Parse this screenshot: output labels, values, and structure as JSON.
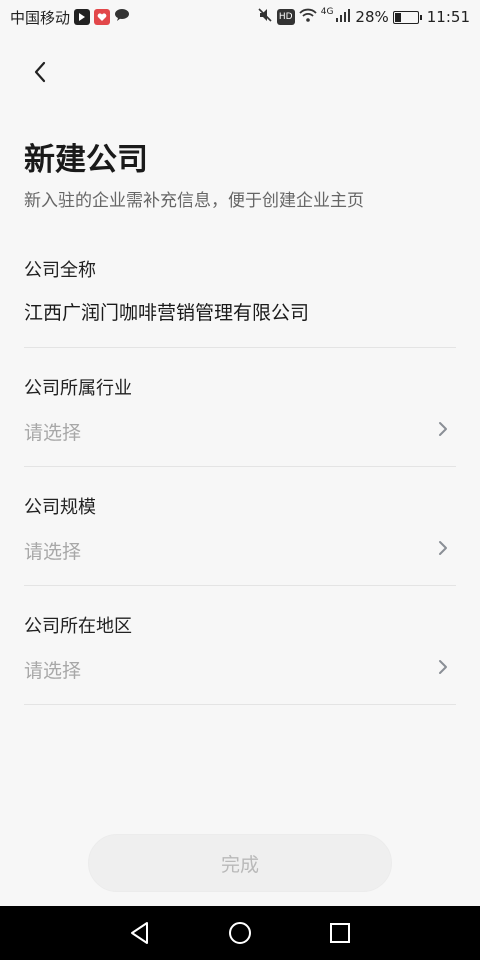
{
  "status_bar": {
    "carrier": "中国移动",
    "hd": "HD",
    "network": "4G",
    "battery": "28%",
    "time": "11:51",
    "battery_level": 0.28,
    "icons": [
      "notification-icon",
      "app-badge-icon",
      "chat-bubble-icon",
      "mute-icon",
      "wifi-icon",
      "signal-icon",
      "battery-icon"
    ]
  },
  "header": {
    "back_icon": "chevron-left-icon"
  },
  "page": {
    "title": "新建公司",
    "subtitle": "新入驻的企业需补充信息，便于创建企业主页"
  },
  "form": {
    "full_name": {
      "label": "公司全称",
      "value": "江西广润门咖啡营销管理有限公司"
    },
    "industry": {
      "label": "公司所属行业",
      "placeholder": "请选择"
    },
    "scale": {
      "label": "公司规模",
      "placeholder": "请选择"
    },
    "region": {
      "label": "公司所在地区",
      "placeholder": "请选择"
    }
  },
  "footer": {
    "done_label": "完成"
  },
  "nav": {
    "icons": [
      "back-triangle-icon",
      "home-circle-icon",
      "recents-square-icon"
    ]
  },
  "colors": {
    "background": "#f7f7f7",
    "placeholder": "#a8a8a8",
    "disabled_button": "#efefef"
  }
}
